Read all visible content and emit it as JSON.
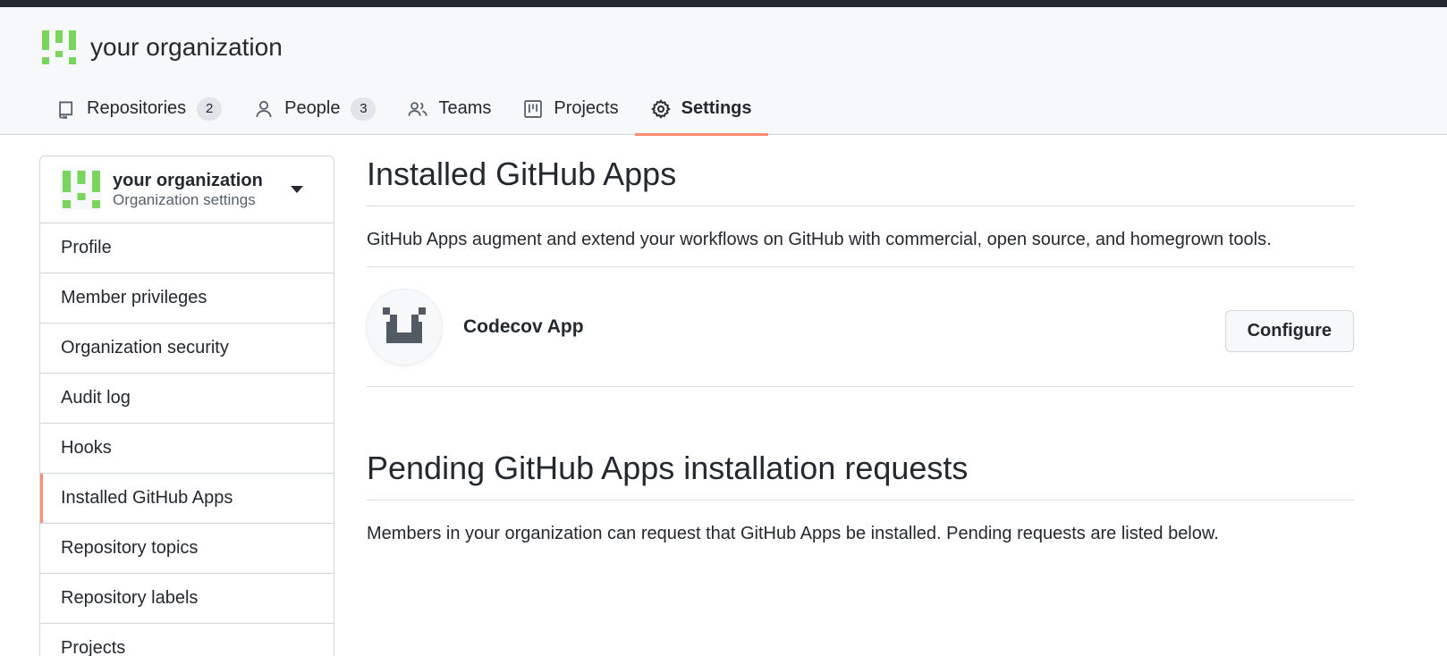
{
  "org": {
    "name": "your organization",
    "settings_subtitle": "Organization settings"
  },
  "tabs": [
    {
      "label": "Repositories",
      "counter": "2",
      "icon": "repo-icon"
    },
    {
      "label": "People",
      "counter": "3",
      "icon": "person-icon"
    },
    {
      "label": "Teams",
      "icon": "people-icon"
    },
    {
      "label": "Projects",
      "icon": "project-icon"
    },
    {
      "label": "Settings",
      "icon": "gear-icon",
      "selected": true
    }
  ],
  "sidebar": {
    "items": [
      {
        "label": "Profile"
      },
      {
        "label": "Member privileges"
      },
      {
        "label": "Organization security"
      },
      {
        "label": "Audit log"
      },
      {
        "label": "Hooks"
      },
      {
        "label": "Installed GitHub Apps",
        "selected": true
      },
      {
        "label": "Repository topics"
      },
      {
        "label": "Repository labels"
      },
      {
        "label": "Projects"
      }
    ]
  },
  "main": {
    "installed": {
      "title": "Installed GitHub Apps",
      "description": "GitHub Apps augment and extend your workflows on GitHub with commercial, open source, and homegrown tools.",
      "apps": [
        {
          "name": "Codecov App",
          "action_label": "Configure"
        }
      ]
    },
    "pending": {
      "title": "Pending GitHub Apps installation requests",
      "description": "Members in your organization can request that GitHub Apps be installed. Pending requests are listed below."
    }
  },
  "colors": {
    "accent_underline": "#fd8c73",
    "identicon_green": "#79d55b",
    "app_icon": "#525a63"
  }
}
